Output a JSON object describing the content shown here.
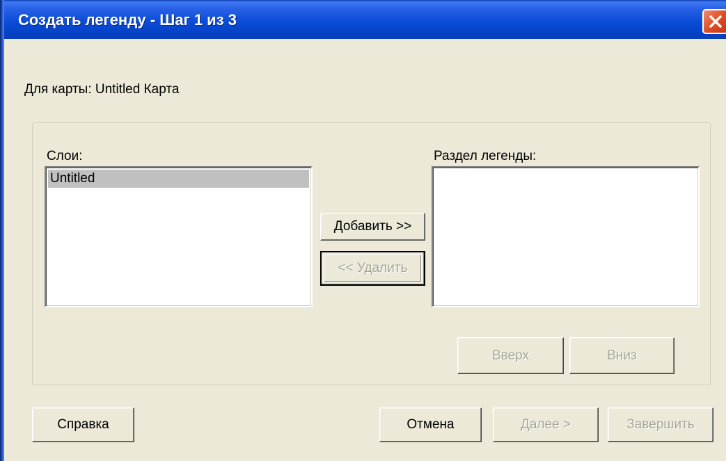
{
  "window": {
    "title": "Создать легенду - Шаг 1 из 3"
  },
  "map_line": "Для карты:  Untitled Карта",
  "layers": {
    "label": "Слои:",
    "items": [
      "Untitled"
    ]
  },
  "legend_section": {
    "label": "Раздел легенды:",
    "items": []
  },
  "buttons": {
    "add": "Добавить >>",
    "remove": "<< Удалить",
    "up": "Вверх",
    "down": "Вниз",
    "help": "Справка",
    "cancel": "Отмена",
    "next": "Далее >",
    "finish": "Завершить"
  },
  "colors": {
    "titlebar": "#0a4bd8",
    "dialog_bg": "#ece9d8",
    "selection": "#c0c0c0",
    "disabled_text": "#a7a699",
    "close_button": "#dd4a22"
  },
  "icons": {
    "close": "close-icon"
  }
}
